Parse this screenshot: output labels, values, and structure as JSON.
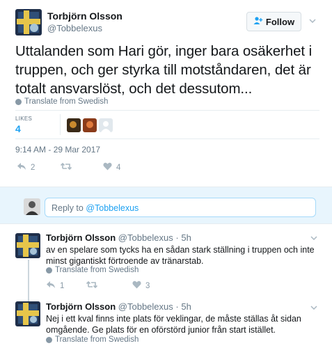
{
  "tweet": {
    "author_name": "Torbjörn Olsson",
    "author_handle": "@Tobbelexus",
    "follow_label": "Follow",
    "text": "Uttalanden som Hari gör, inger bara osäkerhet i truppen, och ger styrka till motståndaren, det är totalt ansvarslöst, och det dessutom...",
    "translate_label": "Translate from Swedish",
    "likes_label": "LIKES",
    "likes_count": "4",
    "timestamp": "9:14 AM - 29 Mar 2017",
    "reply_count": "2",
    "retweet_count": "",
    "like_count": "4"
  },
  "reply_box": {
    "prefix": "Reply to ",
    "mention": "@Tobbelexus"
  },
  "replies": [
    {
      "author_name": "Torbjörn Olsson",
      "author_handle": "@Tobbelexus",
      "time": "5h",
      "text": "av en spelare som tycks ha en sådan stark ställning i truppen och inte minst gigantiskt förtroende av tränarstab.",
      "translate_label": "Translate from Swedish",
      "reply_count": "1",
      "retweet_count": "",
      "like_count": "3"
    },
    {
      "author_name": "Torbjörn Olsson",
      "author_handle": "@Tobbelexus",
      "time": "5h",
      "text": "Nej i ett kval finns inte plats för veklingar, de måste ställas åt sidan omgående. Ge plats för en oförstörd junior från start istället.",
      "translate_label": "Translate from Swedish"
    }
  ],
  "icons": [
    "user-plus-icon",
    "chevron-down-icon",
    "globe-icon",
    "reply-icon",
    "retweet-icon",
    "heart-icon"
  ],
  "colors": {
    "accent": "#1da1f2",
    "muted": "#657786",
    "reply_band": "#e8f5fd"
  }
}
